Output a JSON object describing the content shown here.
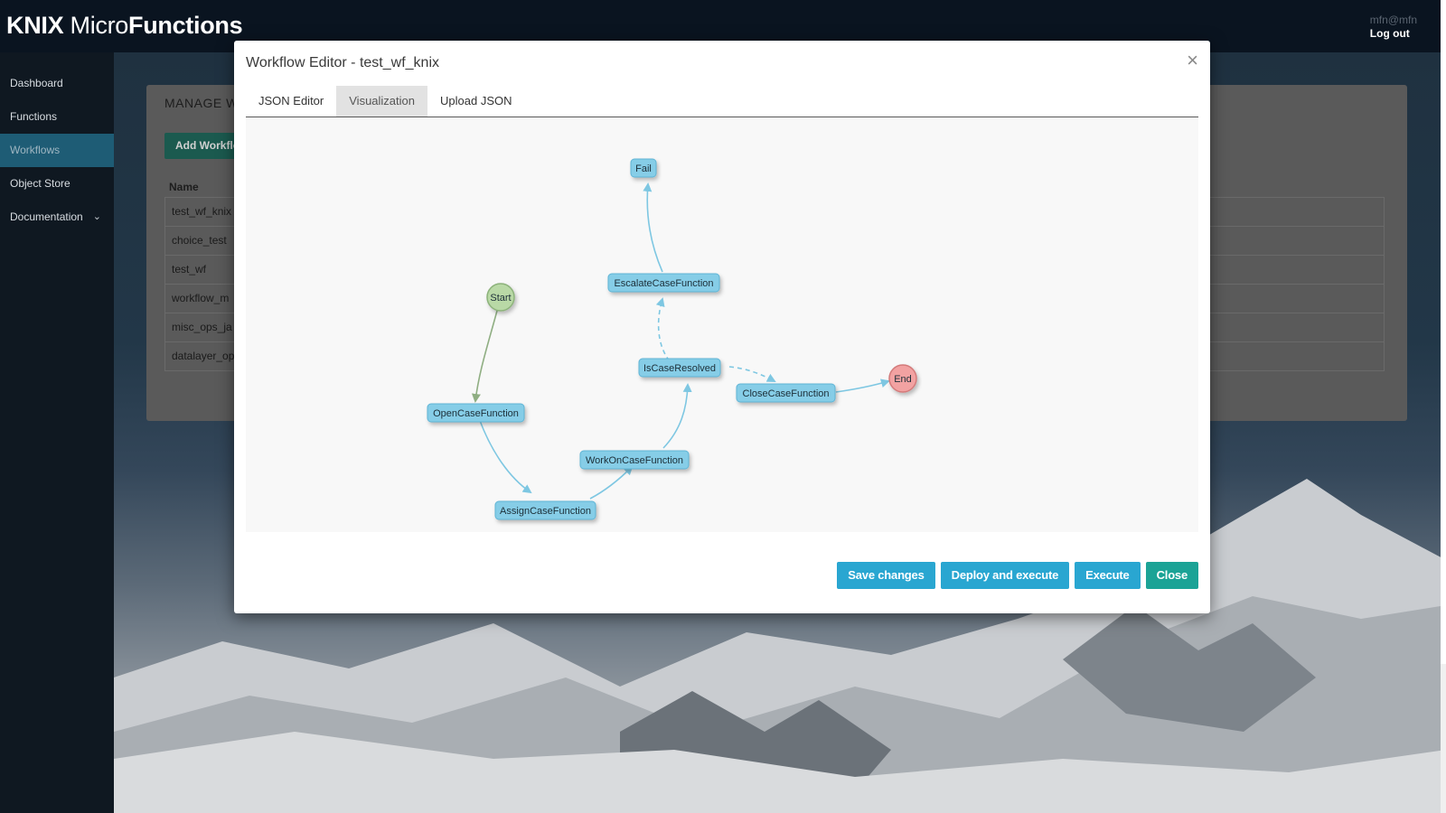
{
  "app": {
    "brand_bold1": "KNIX",
    "brand_light": " Micro",
    "brand_bold2": "Functions",
    "user": "mfn@mfn",
    "logout": "Log out"
  },
  "sidebar": {
    "items": [
      {
        "label": "Dashboard"
      },
      {
        "label": "Functions"
      },
      {
        "label": "Workflows",
        "active": true
      },
      {
        "label": "Object Store"
      },
      {
        "label": "Documentation"
      }
    ]
  },
  "background_panel": {
    "title": "MANAGE W",
    "add_button": "Add Workflo",
    "column_header": "Name",
    "rows": [
      "test_wf_knix",
      "choice_test",
      "test_wf",
      "workflow_m",
      "misc_ops_ja",
      "datalayer_op"
    ]
  },
  "modal": {
    "title": "Workflow Editor - test_wf_knix",
    "close_icon": "×",
    "tabs": [
      {
        "label": "JSON Editor"
      },
      {
        "label": "Visualization",
        "active": true
      },
      {
        "label": "Upload JSON"
      }
    ],
    "graph": {
      "nodes": [
        {
          "id": "start",
          "label": "Start",
          "kind": "start"
        },
        {
          "id": "open",
          "label": "OpenCaseFunction",
          "kind": "task"
        },
        {
          "id": "assign",
          "label": "AssignCaseFunction",
          "kind": "task"
        },
        {
          "id": "work",
          "label": "WorkOnCaseFunction",
          "kind": "task"
        },
        {
          "id": "resolved",
          "label": "IsCaseResolved",
          "kind": "task"
        },
        {
          "id": "escalate",
          "label": "EscalateCaseFunction",
          "kind": "task"
        },
        {
          "id": "fail",
          "label": "Fail",
          "kind": "task"
        },
        {
          "id": "close",
          "label": "CloseCaseFunction",
          "kind": "task"
        },
        {
          "id": "end",
          "label": "End",
          "kind": "end"
        }
      ],
      "colors": {
        "task_fill": "#86cde7",
        "task_stroke": "#5fb5d6",
        "start_fill": "#b9d9a6",
        "start_stroke": "#8cb27a",
        "end_fill": "#f2a2a2",
        "end_stroke": "#d37a7a",
        "edge": "#7ec7e2",
        "start_edge": "#8fae82"
      }
    },
    "buttons": {
      "save": "Save changes",
      "deploy": "Deploy and execute",
      "execute": "Execute",
      "close": "Close"
    }
  }
}
